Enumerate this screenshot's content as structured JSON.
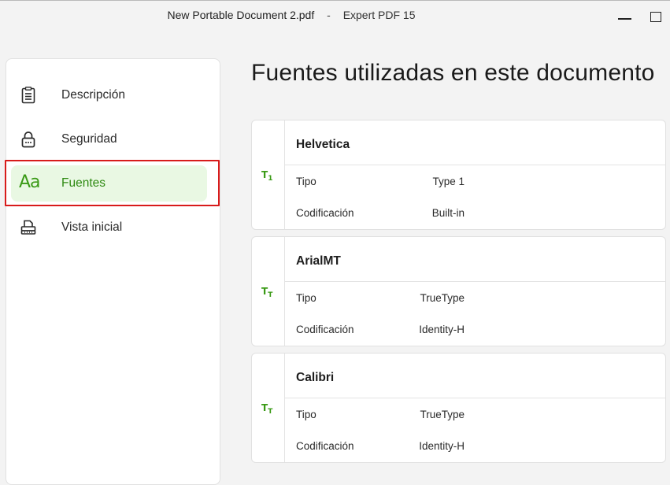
{
  "window": {
    "document_title": "New Portable Document 2.pdf",
    "separator": "-",
    "app_name": "Expert PDF 15"
  },
  "sidebar": {
    "items": [
      {
        "label": "Descripción",
        "icon": "clipboard-icon",
        "active": false
      },
      {
        "label": "Seguridad",
        "icon": "lock-icon",
        "active": false
      },
      {
        "label": "Fuentes",
        "icon": "fonts-aa-icon",
        "active": true
      },
      {
        "label": "Vista inicial",
        "icon": "printer-view-icon",
        "active": false
      }
    ]
  },
  "main": {
    "title": "Fuentes utilizadas en este documento",
    "fonts": [
      {
        "name": "Helvetica",
        "icon_main": "T",
        "icon_sub": "1",
        "type_label": "Tipo",
        "type_value": "Type 1",
        "enc_label": "Codificación",
        "enc_value": "Built-in"
      },
      {
        "name": "ArialMT",
        "icon_main": "T",
        "icon_sub": "T",
        "type_label": "Tipo",
        "type_value": "TrueType",
        "enc_label": "Codificación",
        "enc_value": "Identity-H"
      },
      {
        "name": "Calibri",
        "icon_main": "T",
        "icon_sub": "T",
        "type_label": "Tipo",
        "type_value": "TrueType",
        "enc_label": "Codificación",
        "enc_value": "Identity-H"
      }
    ]
  },
  "colors": {
    "accent_green": "#3a9a16",
    "active_bg": "#e9f8e3",
    "highlight_red": "#d81b1b"
  }
}
